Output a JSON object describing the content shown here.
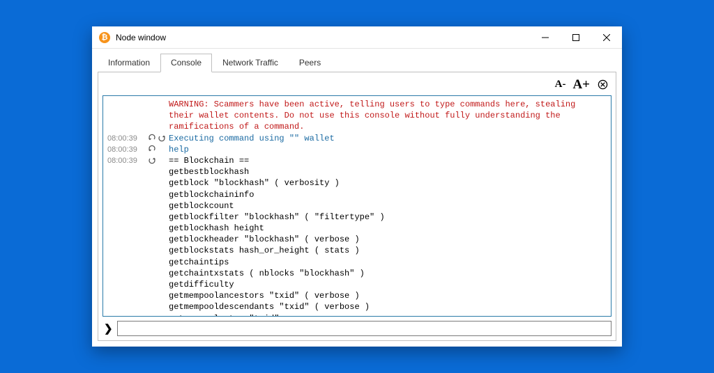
{
  "window": {
    "title": "Node window",
    "app_icon_glyph": "₿"
  },
  "tabs": [
    {
      "label": "Information"
    },
    {
      "label": "Console"
    },
    {
      "label": "Network Traffic"
    },
    {
      "label": "Peers"
    }
  ],
  "active_tab_index": 1,
  "toolbar": {
    "font_smaller": "A-",
    "font_larger": "A+"
  },
  "console": {
    "warning": "WARNING: Scammers have been active, telling users to type commands here, stealing their wallet contents. Do not use this console without fully understanding the ramifications of a command.",
    "rows": [
      {
        "time": "08:00:39",
        "iconset": "updown",
        "color": "cmd",
        "text": "Executing command using \"\" wallet"
      },
      {
        "time": "08:00:39",
        "iconset": "up",
        "color": "cmd",
        "text": "help"
      },
      {
        "time": "08:00:39",
        "iconset": "down",
        "color": "",
        "text": "== Blockchain ==\ngetbestblockhash\ngetblock \"blockhash\" ( verbosity )\ngetblockchaininfo\ngetblockcount\ngetblockfilter \"blockhash\" ( \"filtertype\" )\ngetblockhash height\ngetblockheader \"blockhash\" ( verbose )\ngetblockstats hash_or_height ( stats )\ngetchaintips\ngetchaintxstats ( nblocks \"blockhash\" )\ngetdifficulty\ngetmempoolancestors \"txid\" ( verbose )\ngetmempooldescendants \"txid\" ( verbose )\ngetmempoolentry \"txid\"\ngetmempoolinfo"
      }
    ]
  },
  "prompt_glyph": "❯",
  "command_input_value": ""
}
